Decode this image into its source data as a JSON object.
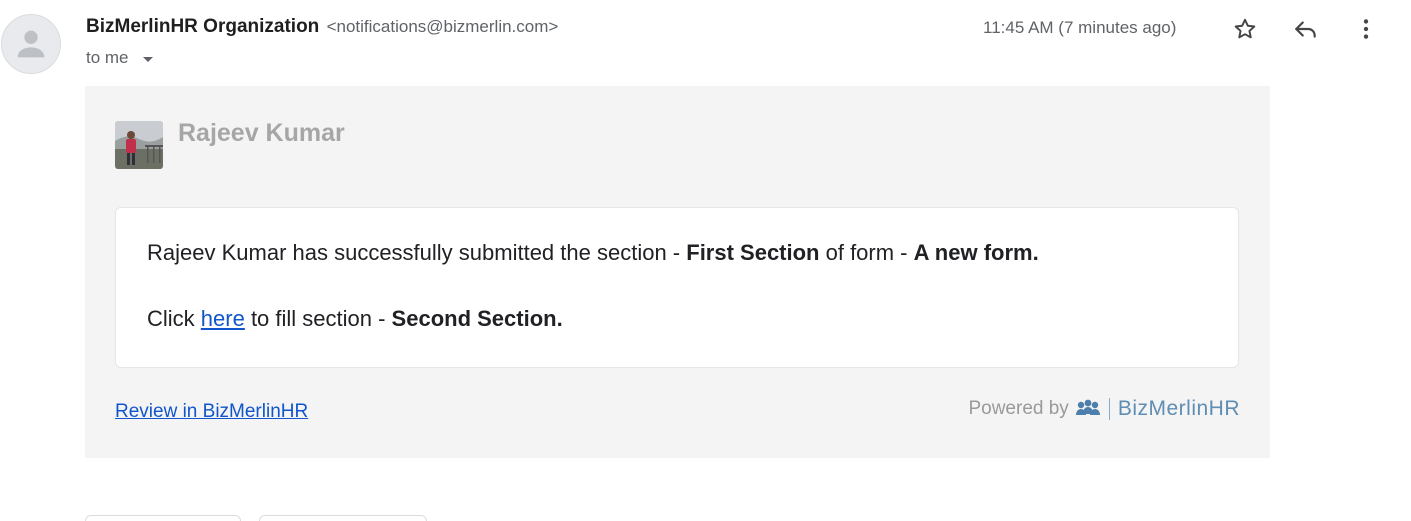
{
  "header": {
    "sender_name": "BizMerlinHR Organization",
    "sender_email": "<notifications@bizmerlin.com>",
    "recipient": "to me",
    "timestamp": "11:45 AM (7 minutes ago)",
    "icons": [
      "person-icon",
      "star-icon",
      "reply-icon",
      "more-vert-icon",
      "chevron-down-icon"
    ]
  },
  "body": {
    "user_name": "Rajeev Kumar",
    "line1": {
      "prefix": "Rajeev Kumar has successfully submitted the section - ",
      "section": "First Section",
      "middle": " of form - ",
      "form": "A new form."
    },
    "line2": {
      "prefix": "Click ",
      "link": "here",
      "middle": " to fill section - ",
      "section": "Second Section."
    },
    "review_link": "Review in BizMerlinHR",
    "powered_by": "Powered by",
    "brand": "BizMerlinHR"
  },
  "colors": {
    "link": "#1155cc",
    "card_bg": "#f4f4f4",
    "brand": "#5f8db3",
    "muted": "#5f6368"
  }
}
